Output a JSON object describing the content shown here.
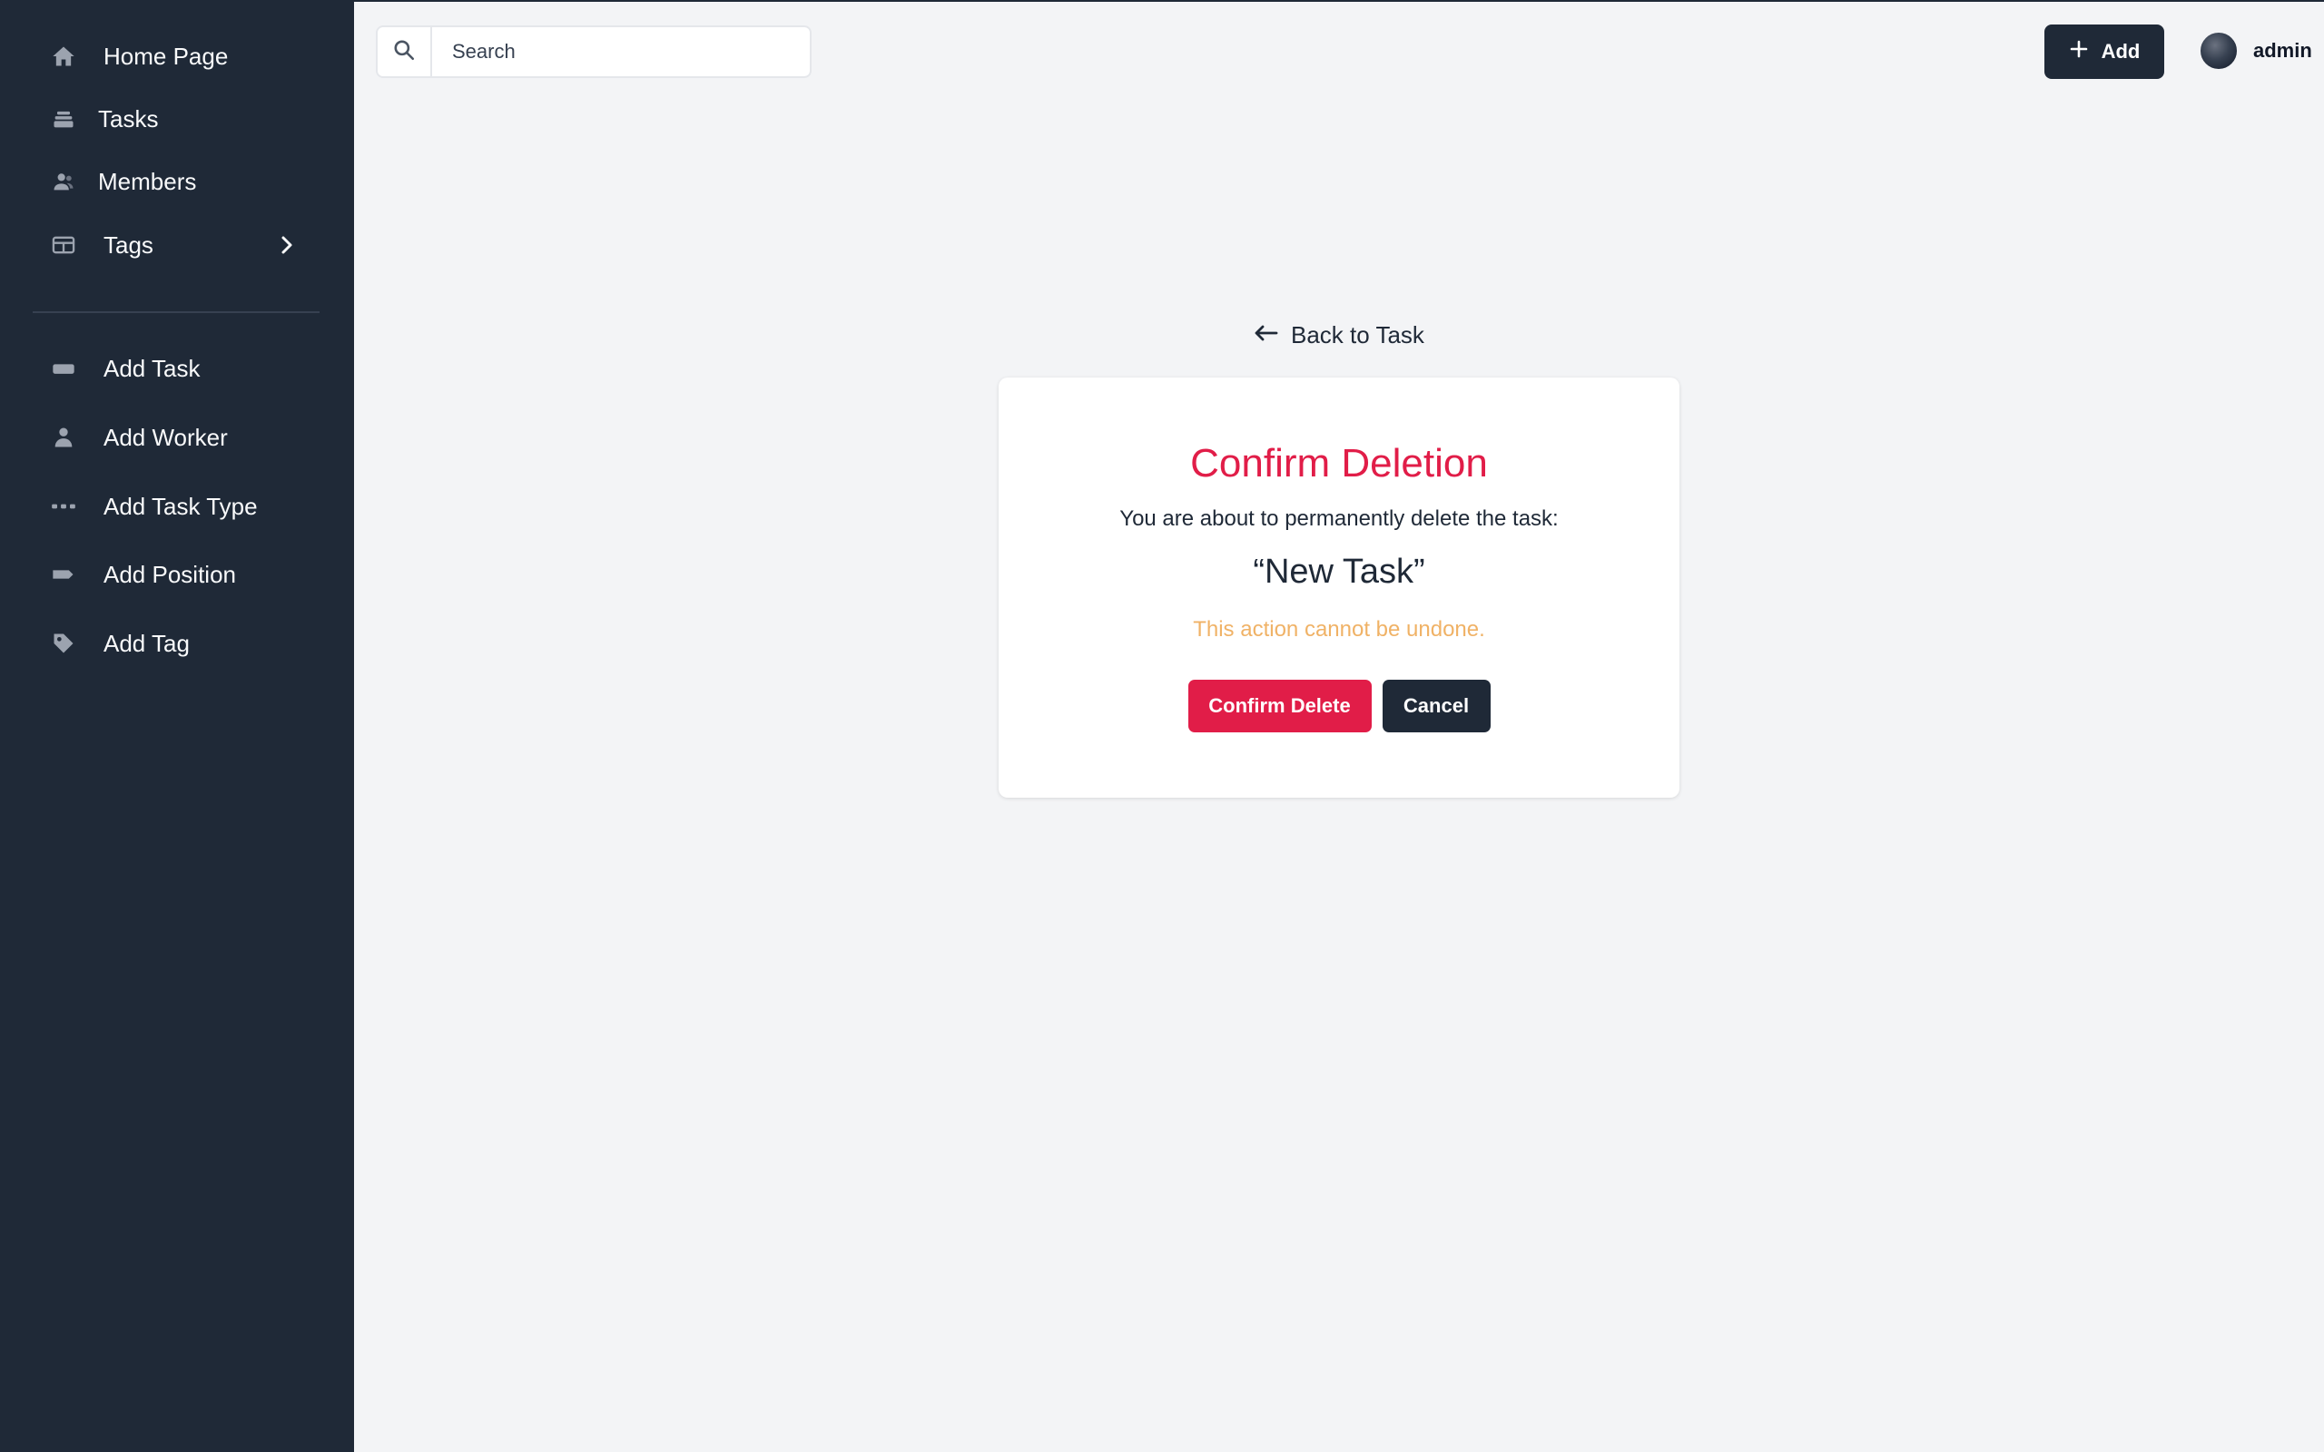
{
  "colors": {
    "sidebar": "#1f2937",
    "accent_danger": "#e11d48",
    "warning": "#f0b266",
    "page_bg": "#f3f4f6"
  },
  "sidebar": {
    "items": [
      {
        "label": "Home Page",
        "icon": "home-icon"
      },
      {
        "label": "Tasks",
        "icon": "layers-icon"
      },
      {
        "label": "Members",
        "icon": "users-icon"
      },
      {
        "label": "Tags",
        "icon": "table-icon"
      },
      {
        "label": "Add Task",
        "icon": "rectangle-icon"
      },
      {
        "label": "Add Worker",
        "icon": "user-icon"
      },
      {
        "label": "Add Task Type",
        "icon": "dots-icon"
      },
      {
        "label": "Add Position",
        "icon": "label-icon"
      },
      {
        "label": "Add Tag",
        "icon": "tag-icon"
      }
    ]
  },
  "header": {
    "search_placeholder": "Search",
    "add_label": "Add",
    "user_name": "admin"
  },
  "main": {
    "back_label": "Back to Task",
    "title": "Confirm Deletion",
    "description": "You are about to permanently delete the task:",
    "task_name": "“New Task”",
    "warning": "This action cannot be undone.",
    "confirm_label": "Confirm Delete",
    "cancel_label": "Cancel"
  }
}
